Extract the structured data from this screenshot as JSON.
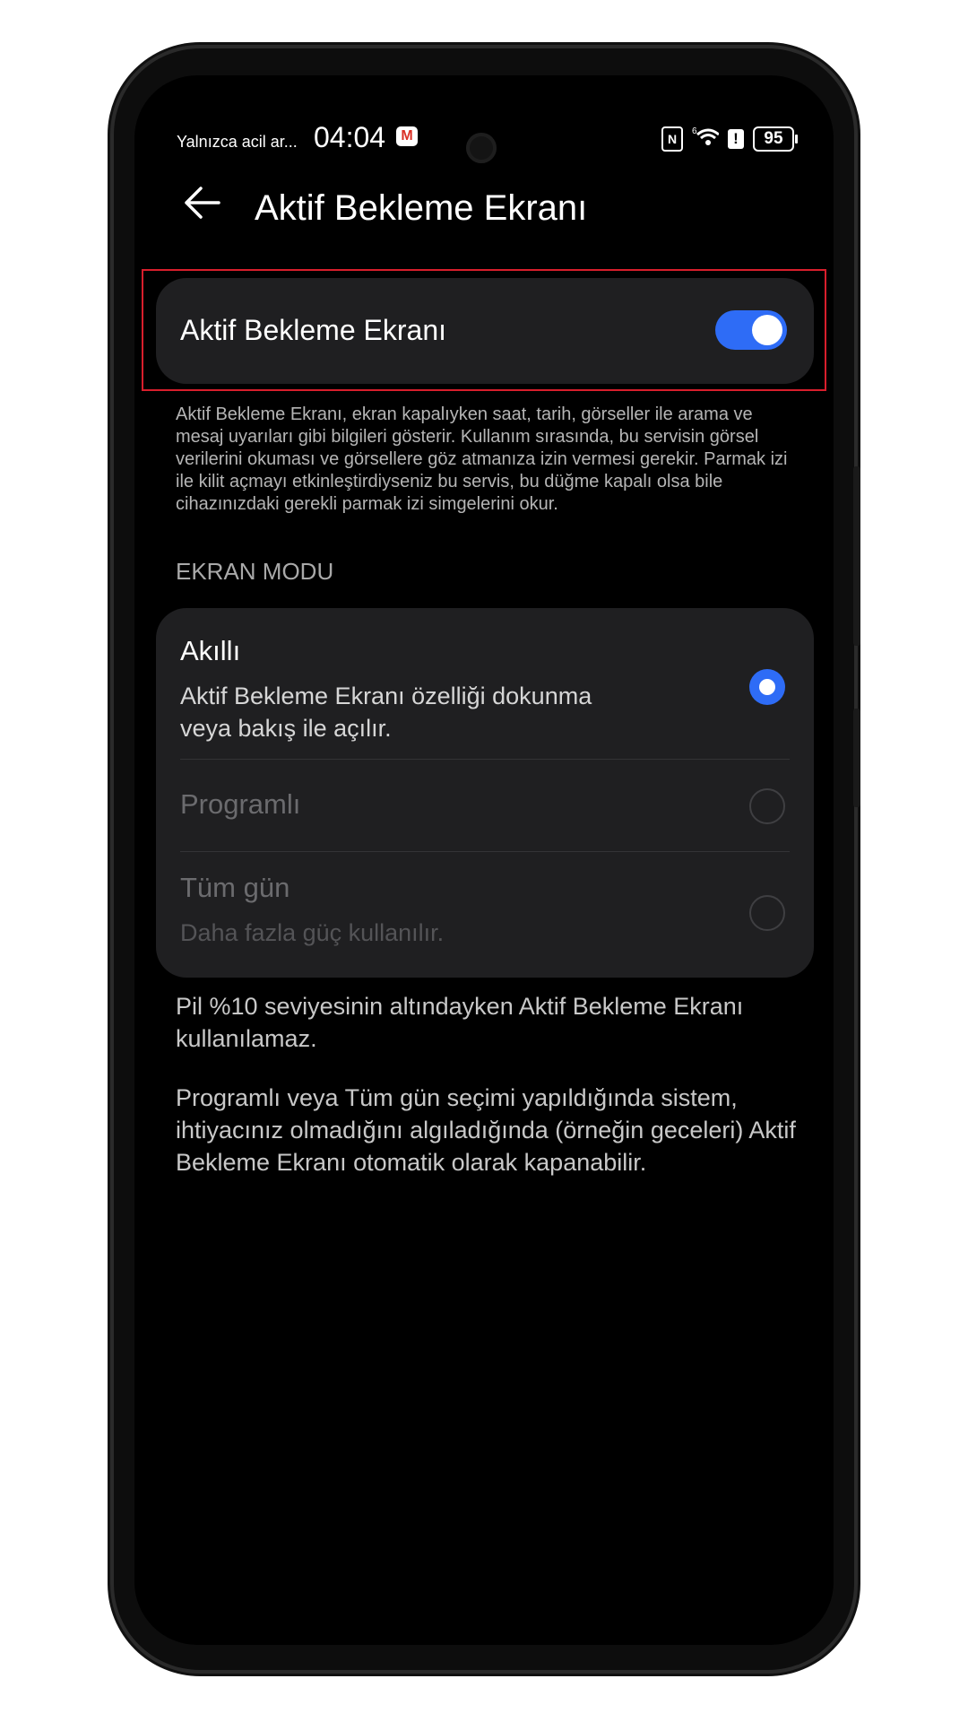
{
  "status_bar": {
    "carrier": "Yalnızca acil ar...",
    "time": "04:04",
    "mail_icon": "gmail-icon",
    "nfc": "N",
    "signal": "6",
    "battery": "95"
  },
  "header": {
    "back_icon": "arrow-left-icon",
    "title": "Aktif Bekleme Ekranı"
  },
  "main_toggle": {
    "label": "Aktif Bekleme Ekranı",
    "enabled": true
  },
  "description": "Aktif Bekleme Ekranı, ekran kapalıyken saat, tarih, görseller ile arama ve mesaj uyarıları gibi bilgileri gösterir. Kullanım sırasında, bu servisin görsel verilerini okuması ve görsellere göz atmanıza izin vermesi gerekir. Parmak izi ile kilit açmayı etkinleştirdiyseniz bu servis, bu düğme kapalı olsa bile cihazınızdaki gerekli parmak izi simgelerini okur.",
  "screen_mode": {
    "header": "EKRAN MODU",
    "options": [
      {
        "title": "Akıllı",
        "subtitle": "Aktif Bekleme Ekranı özelliği dokunma veya bakış ile açılır.",
        "selected": true,
        "enabled": true
      },
      {
        "title": "Programlı",
        "subtitle": "",
        "selected": false,
        "enabled": false
      },
      {
        "title": "Tüm gün",
        "subtitle": "Daha fazla güç kullanılır.",
        "selected": false,
        "enabled": false
      }
    ]
  },
  "notes": [
    "Pil %10 seviyesinin altındayken Aktif Bekleme Ekranı kullanılamaz.",
    "Programlı veya Tüm gün seçimi yapıldığında sistem, ihtiyacınız olmadığını algıladığında (örneğin geceleri) Aktif Bekleme Ekranı otomatik olarak kapanabilir."
  ],
  "colors": {
    "accent": "#2e6cf6",
    "highlight": "#d81e2c",
    "card": "#1f1f21",
    "background": "#000000"
  }
}
